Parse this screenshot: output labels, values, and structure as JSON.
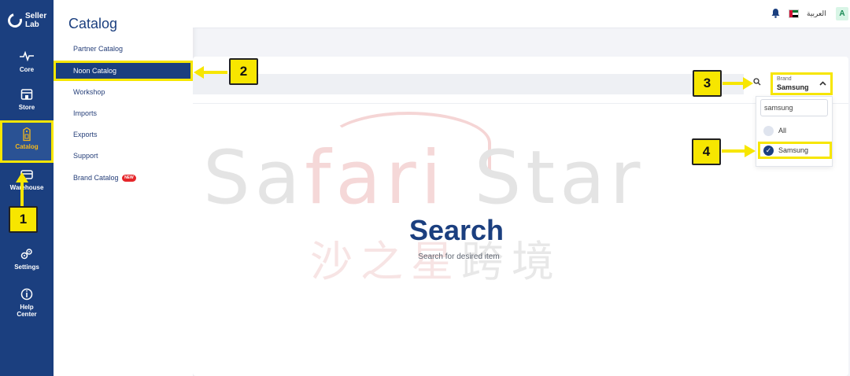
{
  "rail": {
    "logo_line1": "Seller",
    "logo_line2": "Lab",
    "items": [
      {
        "label": "Core",
        "icon": "pulse-icon"
      },
      {
        "label": "Store",
        "icon": "store-icon"
      },
      {
        "label": "Catalog",
        "icon": "tag-icon"
      },
      {
        "label": "Warehouse",
        "icon": "warehouse-icon"
      },
      {
        "label": "Settings",
        "icon": "gears-icon"
      },
      {
        "label_line1": "Help",
        "label_line2": "Center",
        "icon": "info-icon"
      }
    ]
  },
  "submenu": {
    "title": "Catalog",
    "items": [
      {
        "label": "Partner Catalog"
      },
      {
        "label": "Noon Catalog"
      },
      {
        "label": "Workshop"
      },
      {
        "label": "Imports"
      },
      {
        "label": "Exports"
      },
      {
        "label": "Support"
      },
      {
        "label": "Brand Catalog",
        "badge": "NEW"
      }
    ]
  },
  "topbar": {
    "language": "العربية",
    "avatar_letter": "A"
  },
  "brand_filter": {
    "label": "Brand",
    "value": "Samsung",
    "search_value": "samsung",
    "options": [
      {
        "label": "All",
        "checked": false
      },
      {
        "label": "Samsung",
        "checked": true
      }
    ]
  },
  "empty_state": {
    "title": "Search",
    "subtitle": "Search for desired item"
  },
  "watermark": {
    "text_a": "Sa",
    "text_b": "fari",
    "text_c": " Star",
    "cn_a": "沙之星",
    "cn_b": "跨境"
  },
  "steps": [
    "1",
    "2",
    "3",
    "4"
  ],
  "colors": {
    "sidebar": "#1b3f7f",
    "highlight": "#f7e600",
    "brand_blue": "#1b3f7f",
    "active_accent": "#f4b81c"
  }
}
